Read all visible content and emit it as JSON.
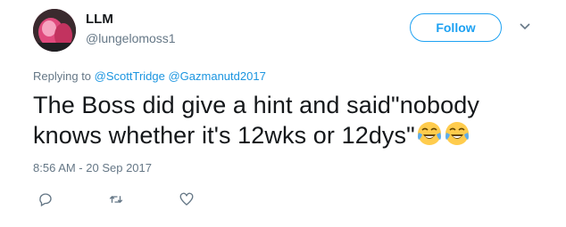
{
  "user": {
    "display_name": "LLM",
    "handle": "@lungelomoss1"
  },
  "follow_label": "Follow",
  "reply": {
    "prefix": "Replying to",
    "mentions": [
      "@ScottTridge",
      "@Gazmanutd2017"
    ]
  },
  "tweet": {
    "text": "The Boss did give a hint and said\"nobody knows whether it's 12wks or 12dys\"",
    "emojis": [
      "face-with-tears-of-joy",
      "face-with-tears-of-joy"
    ]
  },
  "timestamp": "8:56 AM - 20 Sep 2017",
  "actions": [
    "reply-icon",
    "retweet-icon",
    "like-icon"
  ],
  "colors": {
    "accent": "#1da1f2",
    "link": "#1b95e0",
    "secondary_text": "#657786",
    "primary_text": "#14171a"
  }
}
